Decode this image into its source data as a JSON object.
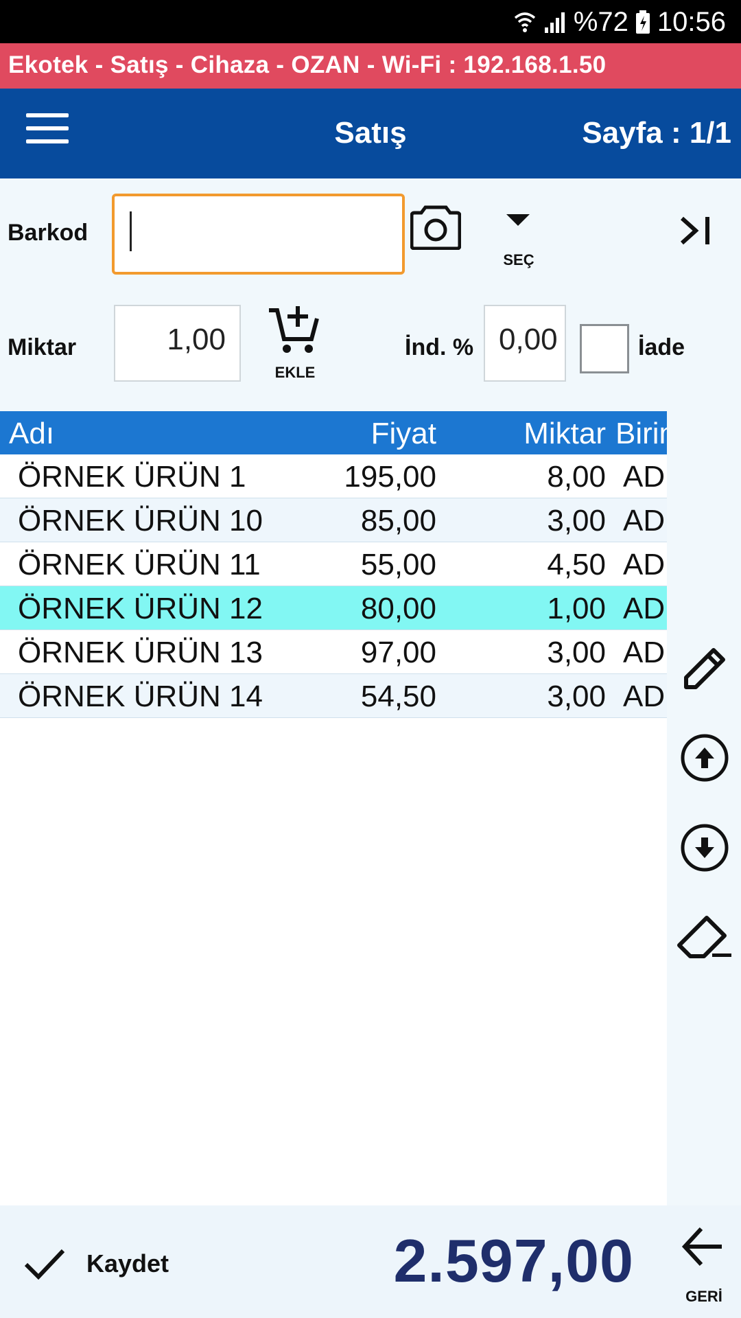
{
  "status_bar": {
    "battery": "%72",
    "time": "10:56"
  },
  "banner": {
    "text": "Ekotek - Satış - Cihaza - OZAN - Wi-Fi : 192.168.1.50"
  },
  "toolbar": {
    "title": "Satış",
    "page_indicator": "Sayfa : 1/1"
  },
  "form": {
    "barcode_label": "Barkod",
    "barcode_value": "",
    "select_label": "SEÇ",
    "quantity_label": "Miktar",
    "quantity_value": "1,00",
    "add_label": "EKLE",
    "discount_label": "İnd. %",
    "discount_value": "0,00",
    "return_label": "İade",
    "return_checked": false
  },
  "table": {
    "headers": {
      "name": "Adı",
      "price": "Fiyat",
      "quantity": "Miktar",
      "unit": "Birim"
    },
    "rows": [
      {
        "name": "ÖRNEK ÜRÜN 1",
        "price": "195,00",
        "quantity": "8,00",
        "unit": "ADET"
      },
      {
        "name": "ÖRNEK ÜRÜN 10",
        "price": "85,00",
        "quantity": "3,00",
        "unit": "ADET"
      },
      {
        "name": "ÖRNEK ÜRÜN 11",
        "price": "55,00",
        "quantity": "4,50",
        "unit": "ADET"
      },
      {
        "name": "ÖRNEK ÜRÜN 12",
        "price": "80,00",
        "quantity": "1,00",
        "unit": "ADET"
      },
      {
        "name": "ÖRNEK ÜRÜN 13",
        "price": "97,00",
        "quantity": "3,00",
        "unit": "ADET"
      },
      {
        "name": "ÖRNEK ÜRÜN 14",
        "price": "54,50",
        "quantity": "3,00",
        "unit": "ADET"
      }
    ],
    "selected_row": 3
  },
  "footer": {
    "save_label": "Kaydet",
    "total": "2.597,00",
    "back_label": "GERİ"
  },
  "colors": {
    "banner": "#e04a5f",
    "toolbar": "#074b9d",
    "table_header": "#1c77d1",
    "selected_row": "#82f7f3",
    "barcode_border": "#f29a2e",
    "total_text": "#1f2e6b"
  },
  "icons": {
    "menu": "hamburger-menu-icon",
    "camera": "camera-icon",
    "select": "dropdown-arrow-icon",
    "skip": "skip-end-icon",
    "add": "add-to-cart-icon",
    "edit": "pencil-icon",
    "move_up": "arrow-up-circle-icon",
    "move_down": "arrow-down-circle-icon",
    "clear": "eraser-icon",
    "save": "checkmark-icon",
    "back": "arrow-left-icon"
  }
}
